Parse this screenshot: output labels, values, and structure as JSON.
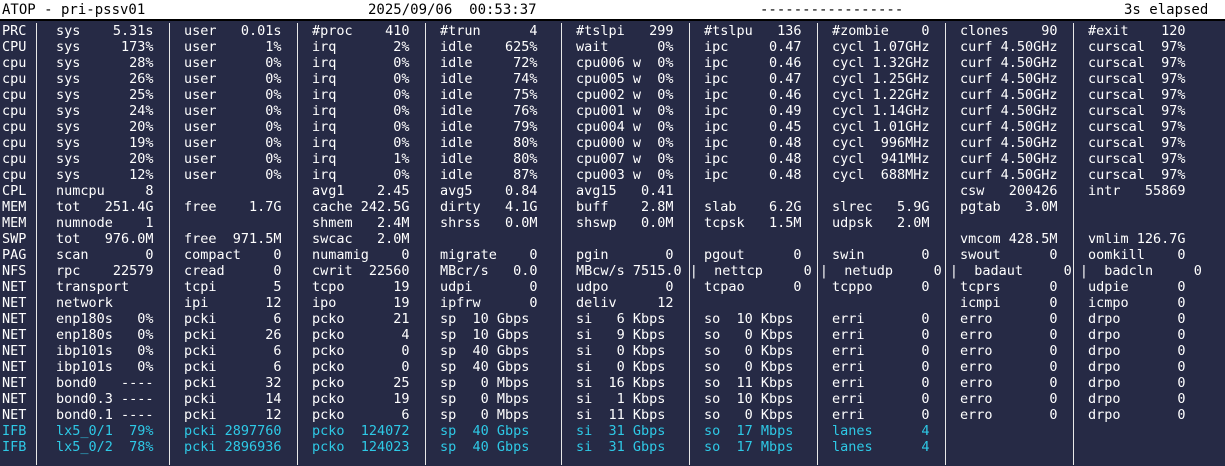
{
  "header": {
    "title": "ATOP - pri-pssv01",
    "datetime": "2025/09/06  00:53:37",
    "dashes": "-----------------",
    "elapsed": "3s elapsed"
  },
  "colors": {
    "background": "#262a45",
    "text": "#ffffff",
    "highlight": "#2ec9e6",
    "header_bg": "#ffffff"
  },
  "rows": [
    {
      "label": "PRC",
      "cells": [
        "sys    5.31s",
        "user   0.01s",
        "#proc    410",
        "#trun      4",
        "#tslpi   299",
        "#tslpu   136",
        "#zombie    0",
        "clones    90",
        "#exit    120"
      ]
    },
    {
      "label": "CPU",
      "cells": [
        "sys     173%",
        "user      1%",
        "irq       2%",
        "idle    625%",
        "wait      0%",
        "ipc     0.47",
        "cycl 1.07GHz",
        "curf 4.50GHz",
        "curscal  97%"
      ]
    },
    {
      "label": "cpu",
      "cells": [
        "sys      28%",
        "user      0%",
        "irq       0%",
        "idle     72%",
        "cpu006 w  0%",
        "ipc     0.46",
        "cycl 1.32GHz",
        "curf 4.50GHz",
        "curscal  97%"
      ]
    },
    {
      "label": "cpu",
      "cells": [
        "sys      26%",
        "user      0%",
        "irq       0%",
        "idle     74%",
        "cpu005 w  0%",
        "ipc     0.47",
        "cycl 1.25GHz",
        "curf 4.50GHz",
        "curscal  97%"
      ]
    },
    {
      "label": "cpu",
      "cells": [
        "sys      25%",
        "user      0%",
        "irq       0%",
        "idle     75%",
        "cpu002 w  0%",
        "ipc     0.46",
        "cycl 1.22GHz",
        "curf 4.50GHz",
        "curscal  97%"
      ]
    },
    {
      "label": "cpu",
      "cells": [
        "sys      24%",
        "user      0%",
        "irq       0%",
        "idle     76%",
        "cpu001 w  0%",
        "ipc     0.49",
        "cycl 1.14GHz",
        "curf 4.50GHz",
        "curscal  97%"
      ]
    },
    {
      "label": "cpu",
      "cells": [
        "sys      20%",
        "user      0%",
        "irq       0%",
        "idle     79%",
        "cpu004 w  0%",
        "ipc     0.45",
        "cycl 1.01GHz",
        "curf 4.50GHz",
        "curscal  97%"
      ]
    },
    {
      "label": "cpu",
      "cells": [
        "sys      19%",
        "user      0%",
        "irq       0%",
        "idle     80%",
        "cpu000 w  0%",
        "ipc     0.48",
        "cycl  996MHz",
        "curf 4.50GHz",
        "curscal  97%"
      ]
    },
    {
      "label": "cpu",
      "cells": [
        "sys      20%",
        "user      0%",
        "irq       1%",
        "idle     80%",
        "cpu007 w  0%",
        "ipc     0.48",
        "cycl  941MHz",
        "curf 4.50GHz",
        "curscal  97%"
      ]
    },
    {
      "label": "cpu",
      "cells": [
        "sys      12%",
        "user      0%",
        "irq       0%",
        "idle     87%",
        "cpu003 w  0%",
        "ipc     0.48",
        "cycl  688MHz",
        "curf 4.50GHz",
        "curscal  97%"
      ]
    },
    {
      "label": "CPL",
      "cells": [
        "numcpu     8",
        "",
        "avg1    2.45",
        "avg5    0.84",
        "avg15   0.41",
        "",
        "",
        "csw   200426",
        "intr   55869"
      ]
    },
    {
      "label": "MEM",
      "cells": [
        "tot   251.4G",
        "free    1.7G",
        "cache 242.5G",
        "dirty   4.1G",
        "buff    2.8M",
        "slab    6.2G",
        "slrec   5.9G",
        "pgtab   3.0M",
        ""
      ]
    },
    {
      "label": "MEM",
      "cells": [
        "numnode    1",
        "",
        "shmem   2.4M",
        "shrss   0.0M",
        "shswp   0.0M",
        "tcpsk   1.5M",
        "udpsk   2.0M",
        "",
        ""
      ]
    },
    {
      "label": "SWP",
      "cells": [
        "tot   976.0M",
        "free  971.5M",
        "swcac   2.0M",
        "",
        "",
        "",
        "",
        "vmcom 428.5M",
        "vmlim 126.7G"
      ]
    },
    {
      "label": "PAG",
      "cells": [
        "scan       0",
        "compact    0",
        "numamig    0",
        "migrate    0",
        "pgin       0",
        "pgout      0",
        "swin       0",
        "swout      0",
        "oomkill    0"
      ]
    },
    {
      "label": "NFS",
      "cells": [
        "rpc    22579",
        "cread      0",
        "cwrit  22560",
        "MBcr/s   0.0",
        "MBcw/s 7515.0 |  nettcp     0 |  netudp     0 |  badaut     0 |  badcln     0",
        "",
        "",
        "",
        ""
      ]
    },
    {
      "label": "NET",
      "cells": [
        "transport",
        "tcpi       5",
        "tcpo      19",
        "udpi       0",
        "udpo       0",
        "tcpao      0",
        "tcppo      0",
        "tcprs      0",
        "udpie      0"
      ]
    },
    {
      "label": "NET",
      "cells": [
        "network",
        "ipi       12",
        "ipo       19",
        "ipfrw      0",
        "deliv     12",
        "",
        "",
        "icmpi      0",
        "icmpo      0"
      ]
    },
    {
      "label": "NET",
      "cells": [
        "enp180s   0%",
        "pcki       6",
        "pcko      21",
        "sp  10 Gbps",
        "si   6 Kbps",
        "so  10 Kbps",
        "erri       0",
        "erro       0",
        "drpo       0"
      ]
    },
    {
      "label": "NET",
      "cells": [
        "enp180s   0%",
        "pcki      26",
        "pcko       4",
        "sp  10 Gbps",
        "si   9 Kbps",
        "so   0 Kbps",
        "erri       0",
        "erro       0",
        "drpo       0"
      ]
    },
    {
      "label": "NET",
      "cells": [
        "ibp101s   0%",
        "pcki       6",
        "pcko       0",
        "sp  40 Gbps",
        "si   0 Kbps",
        "so   0 Kbps",
        "erri       0",
        "erro       0",
        "drpo       0"
      ]
    },
    {
      "label": "NET",
      "cells": [
        "ibp101s   0%",
        "pcki       6",
        "pcko       0",
        "sp  40 Gbps",
        "si   0 Kbps",
        "so   0 Kbps",
        "erri       0",
        "erro       0",
        "drpo       0"
      ]
    },
    {
      "label": "NET",
      "cells": [
        "bond0   ----",
        "pcki      32",
        "pcko      25",
        "sp   0 Mbps",
        "si  16 Kbps",
        "so  11 Kbps",
        "erri       0",
        "erro       0",
        "drpo       0"
      ]
    },
    {
      "label": "NET",
      "cells": [
        "bond0.3 ----",
        "pcki      14",
        "pcko      19",
        "sp   0 Mbps",
        "si   1 Kbps",
        "so  10 Kbps",
        "erri       0",
        "erro       0",
        "drpo       0"
      ]
    },
    {
      "label": "NET",
      "cells": [
        "bond0.1 ----",
        "pcki      12",
        "pcko       6",
        "sp   0 Mbps",
        "si  11 Kbps",
        "so   0 Kbps",
        "erri       0",
        "erro       0",
        "drpo       0"
      ]
    },
    {
      "label": "IFB",
      "highlight": true,
      "cells": [
        "lx5_0/1  79%",
        "pcki 2897760",
        "pcko  124072",
        "sp  40 Gbps",
        "si  31 Gbps",
        "so  17 Mbps",
        "lanes      4",
        "",
        ""
      ]
    },
    {
      "label": "IFB",
      "highlight": true,
      "cells": [
        "lx5_0/2  78%",
        "pcki 2896936",
        "pcko  124023",
        "sp  40 Gbps",
        "si  31 Gbps",
        "so  17 Mbps",
        "lanes      4",
        "",
        ""
      ]
    }
  ]
}
